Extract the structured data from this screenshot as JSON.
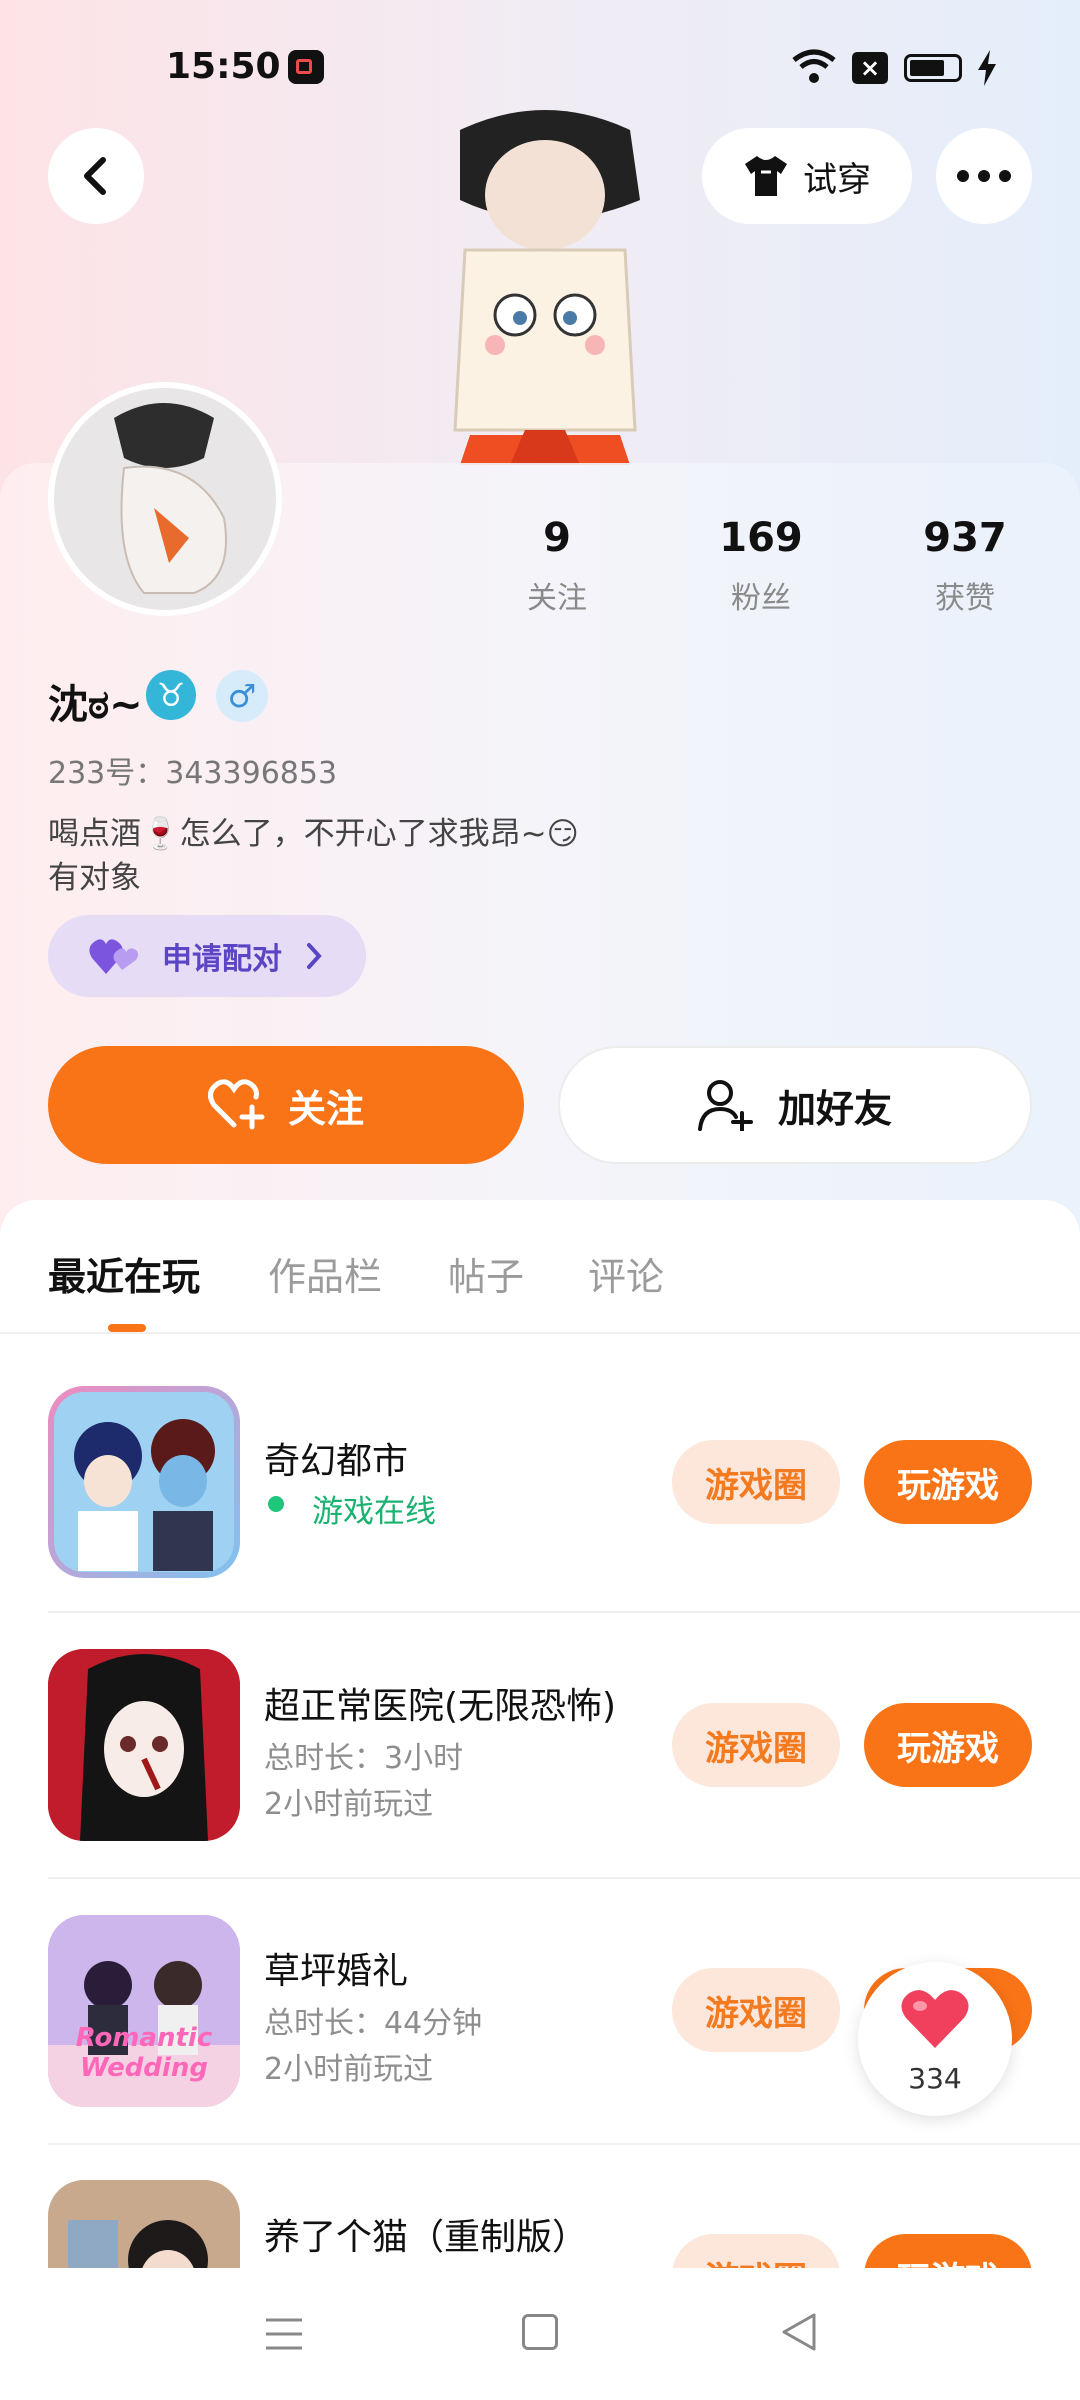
{
  "status_bar": {
    "time": "15:50"
  },
  "header": {
    "try_on_label": "试穿"
  },
  "profile": {
    "name": "沈ಠ~",
    "id_text": "233号：343396853",
    "bio_line1": "喝点酒🍷怎么了，不开心了求我昂~😏",
    "bio_line2": "有对象",
    "pair_label": "申请配对",
    "zodiac_symbol": "♉",
    "gender_symbol": "♂",
    "stats": [
      {
        "value": "9",
        "label": "关注"
      },
      {
        "value": "169",
        "label": "粉丝"
      },
      {
        "value": "937",
        "label": "获赞"
      }
    ]
  },
  "actions": {
    "follow_label": "关注",
    "add_friend_label": "加好友"
  },
  "tabs": [
    {
      "label": "最近在玩"
    },
    {
      "label": "作品栏"
    },
    {
      "label": "帖子"
    },
    {
      "label": "评论"
    }
  ],
  "games": [
    {
      "title": "奇幻都市",
      "status": "游戏在线",
      "circle_label": "游戏圈",
      "play_label": "玩游戏"
    },
    {
      "title": "超正常医院(无限恐怖)",
      "duration": "总时长：3小时",
      "last_played": "2小时前玩过",
      "circle_label": "游戏圈",
      "play_label": "玩游戏"
    },
    {
      "title": "草坪婚礼",
      "duration": "总时长：44分钟",
      "last_played": "2小时前玩过",
      "circle_label": "游戏圈",
      "play_label": "玩游戏",
      "icon_text": "Romantic Wedding"
    },
    {
      "title": "养了个猫（重制版）",
      "circle_label": "游戏圈",
      "play_label": "玩游戏"
    }
  ],
  "floating_like": {
    "count": "334"
  },
  "colors": {
    "accent": "#f97417",
    "online": "#1fc77b",
    "pair_bg": "#e6dcf6",
    "pair_text": "#5b45c4"
  }
}
